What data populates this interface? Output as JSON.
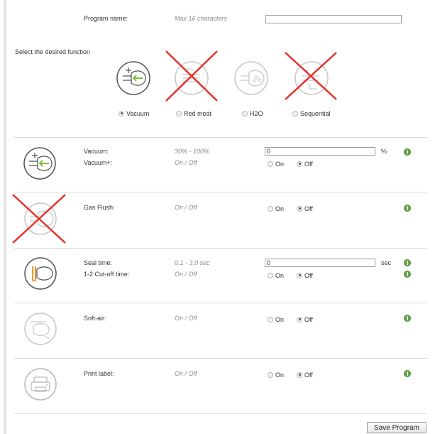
{
  "program": {
    "name_label": "Program name:",
    "name_hint": "Max 16 characters",
    "name_value": ""
  },
  "function_select": {
    "title": "Select the desired function",
    "options": [
      {
        "label": "Vacuum",
        "icon": "vacuum-icon",
        "checked": true,
        "disabled": false
      },
      {
        "label": "Red meat",
        "icon": "red-meat-icon",
        "checked": false,
        "disabled": true
      },
      {
        "label": "H2O",
        "icon": "h2o-icon",
        "checked": false,
        "disabled": false
      },
      {
        "label": "Sequential",
        "icon": "sequential-icon",
        "checked": false,
        "disabled": true
      }
    ]
  },
  "vacuum": {
    "label": "Vacuum:",
    "range": "30% - 100%",
    "value": "0",
    "unit": "%",
    "plus_label": "Vacuum+:",
    "plus_range": "On / Off",
    "plus_on": "On",
    "plus_off": "Off",
    "plus_state": "off"
  },
  "gas_flush": {
    "label": "Gas Flush:",
    "range": "On / Off",
    "on": "On",
    "off": "Off",
    "state": "off",
    "disabled": true
  },
  "seal": {
    "label": "Seal time:",
    "range": "0.1 - 3.0 sec",
    "value": "0",
    "unit": "sec",
    "cutoff_label": "1-2 Cut-off time:",
    "cutoff_range": "On / Off",
    "cutoff_on": "On",
    "cutoff_off": "Off",
    "cutoff_state": "off"
  },
  "soft_air": {
    "label": "Soft-air:",
    "range": "On / Off",
    "on": "On",
    "off": "Off",
    "state": "off"
  },
  "print_label": {
    "label": "Print label:",
    "range": "On / Off",
    "on": "On",
    "off": "Off",
    "state": "off"
  },
  "actions": {
    "save": "Save Program"
  },
  "colors": {
    "accent_green": "#7cc242",
    "cross_red": "#e8302a",
    "seal_orange": "#e39a3c",
    "info_green": "#6aa84f"
  }
}
